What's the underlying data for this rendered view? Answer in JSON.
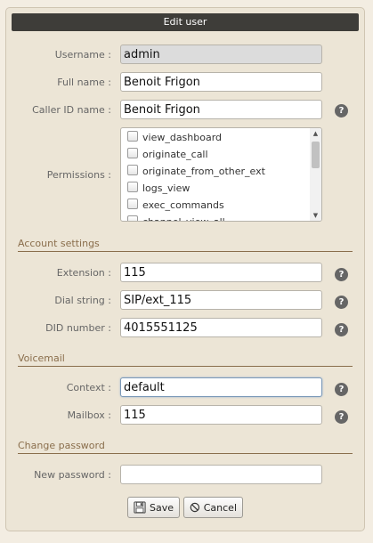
{
  "dialog": {
    "title": "Edit user"
  },
  "fields": {
    "username": {
      "label": "Username :",
      "value": "admin"
    },
    "fullname": {
      "label": "Full name :",
      "value": "Benoit Frigon"
    },
    "callerid": {
      "label": "Caller ID name :",
      "value": "Benoit Frigon"
    }
  },
  "permissions": {
    "label": "Permissions :",
    "items": [
      "view_dashboard",
      "originate_call",
      "originate_from_other_ext",
      "logs_view",
      "exec_commands",
      "channel_view_all"
    ]
  },
  "account_settings": {
    "heading": "Account settings",
    "extension": {
      "label": "Extension :",
      "value": "115"
    },
    "dial_string": {
      "label": "Dial string :",
      "value": "SIP/ext_115"
    },
    "did_number": {
      "label": "DID number :",
      "value": "4015551125"
    }
  },
  "voicemail": {
    "heading": "Voicemail",
    "context": {
      "label": "Context :",
      "value": "default"
    },
    "mailbox": {
      "label": "Mailbox :",
      "value": "115"
    }
  },
  "change_password": {
    "heading": "Change password",
    "new_password": {
      "label": "New password :",
      "value": ""
    }
  },
  "buttons": {
    "save": "Save",
    "cancel": "Cancel"
  },
  "help_glyph": "?"
}
